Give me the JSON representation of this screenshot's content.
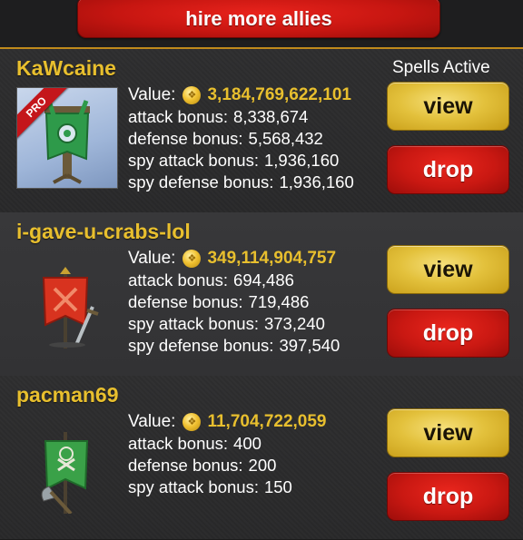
{
  "header": {
    "hire_label": "hire more allies"
  },
  "spells_label": "Spells Active",
  "labels": {
    "value": "Value:",
    "attack": "attack bonus:",
    "defense": "defense bonus:",
    "spy_attack": "spy attack bonus:",
    "spy_defense": "spy defense bonus:",
    "view": "view",
    "drop": "drop"
  },
  "allies": [
    {
      "name": "KaWcaine",
      "badge": "PRO",
      "avatar_icon": "green-banner-tree-icon",
      "value": "3,184,769,622,101",
      "attack_bonus": "8,338,674",
      "defense_bonus": "5,568,432",
      "spy_attack_bonus": "1,936,160",
      "spy_defense_bonus": "1,936,160"
    },
    {
      "name": "i-gave-u-crabs-lol",
      "avatar_icon": "red-banner-sword-icon",
      "value": "349,114,904,757",
      "attack_bonus": "694,486",
      "defense_bonus": "719,486",
      "spy_attack_bonus": "373,240",
      "spy_defense_bonus": "397,540"
    },
    {
      "name": "pacman69",
      "avatar_icon": "green-banner-axe-icon",
      "value": "11,704,722,059",
      "attack_bonus": "400",
      "defense_bonus": "200",
      "spy_attack_bonus": "150"
    }
  ],
  "colors": {
    "accent_gold": "#e8bf2e",
    "button_red": "#c91812",
    "button_gold": "#e3c13c",
    "background": "#2b2b2c"
  }
}
